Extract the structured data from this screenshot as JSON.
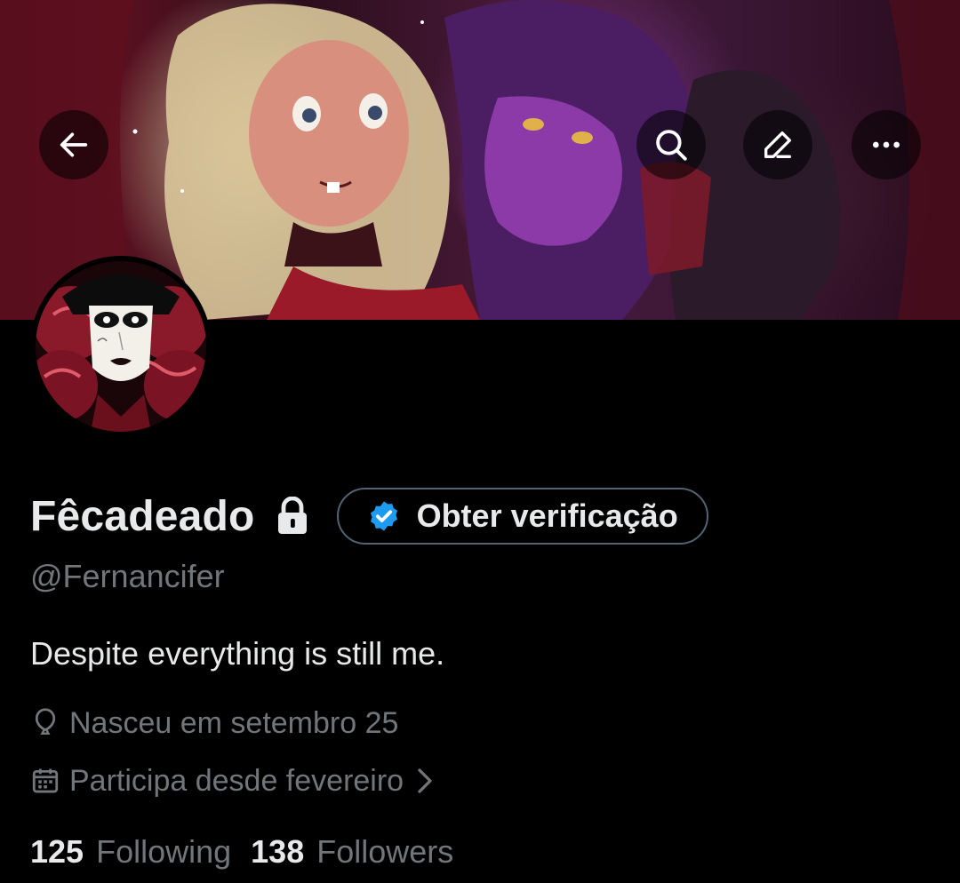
{
  "profile": {
    "display_name": "Fêcadeado",
    "handle": "@Fernancifer",
    "bio": "Despite everything is still me.",
    "verify_label": "Obter verificação",
    "birthday": "Nasceu em setembro 25",
    "joined": "Participa desde fevereiro",
    "following_count": "125",
    "following_label": "Following",
    "followers_count": "138",
    "followers_label": "Followers"
  },
  "icons": {
    "back": "arrow-left-icon",
    "search": "search-icon",
    "edit": "pencil-icon",
    "more": "more-icon",
    "lock": "lock-icon",
    "verified": "verified-badge-icon",
    "birthday": "balloon-icon",
    "calendar": "calendar-icon",
    "chevron": "chevron-right-icon"
  },
  "colors": {
    "background": "#000000",
    "primary_text": "#e7e9ea",
    "secondary_text": "#71767b",
    "verified_blue": "#1d9bf0",
    "button_border": "#536471"
  }
}
